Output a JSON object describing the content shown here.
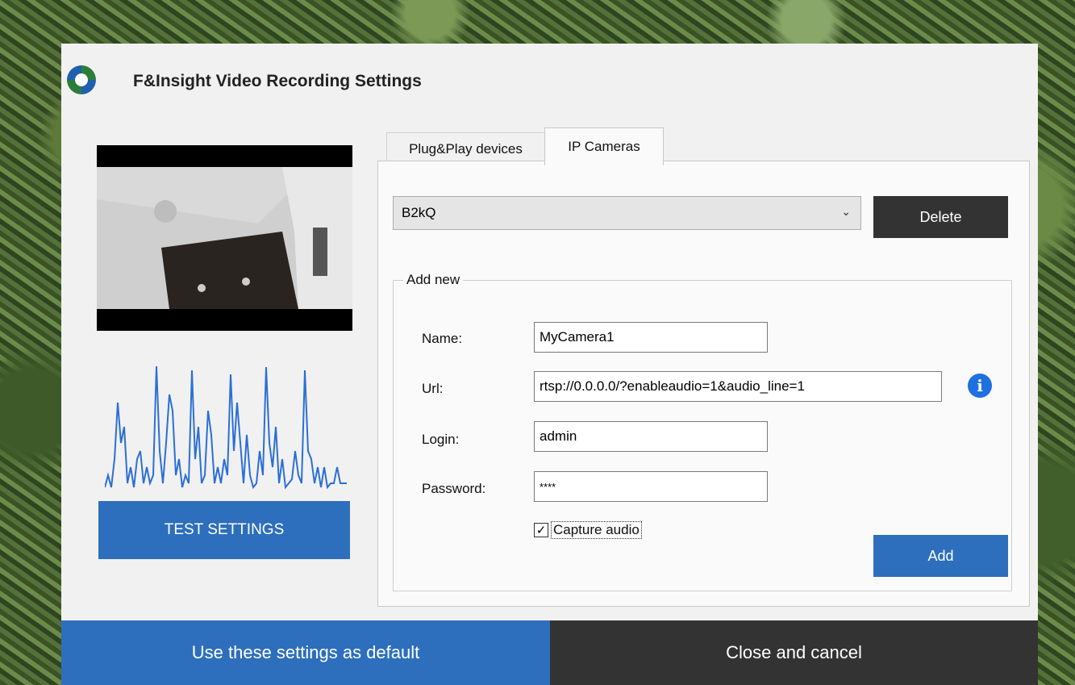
{
  "window": {
    "title": "F&Insight Video Recording Settings"
  },
  "left": {
    "test_button": "TEST SETTINGS"
  },
  "tabs": [
    {
      "label": "Plug&Play devices",
      "active": false
    },
    {
      "label": "IP Cameras",
      "active": true
    }
  ],
  "ip_cameras": {
    "selected_camera": "B2kQ",
    "delete_label": "Delete",
    "add_new": {
      "group_label": "Add new",
      "name_label": "Name:",
      "name_value": "MyCamera1",
      "url_label": "Url:",
      "url_value": "rtsp://0.0.0.0/?enableaudio=1&audio_line=1",
      "login_label": "Login:",
      "login_value": "admin",
      "password_label": "Password:",
      "password_value": "****",
      "capture_audio_label": "Capture audio",
      "capture_audio_checked": true,
      "add_label": "Add"
    }
  },
  "footer": {
    "default_label": "Use these settings as default",
    "cancel_label": "Close and cancel"
  },
  "colors": {
    "accent_blue": "#2d6fbd",
    "dark": "#333333",
    "info_blue": "#1e6fe0"
  },
  "icons": {
    "logo": "aperture-logo-icon",
    "info": "info-icon",
    "dropdown": "chevron-down-icon",
    "check": "check-icon"
  }
}
